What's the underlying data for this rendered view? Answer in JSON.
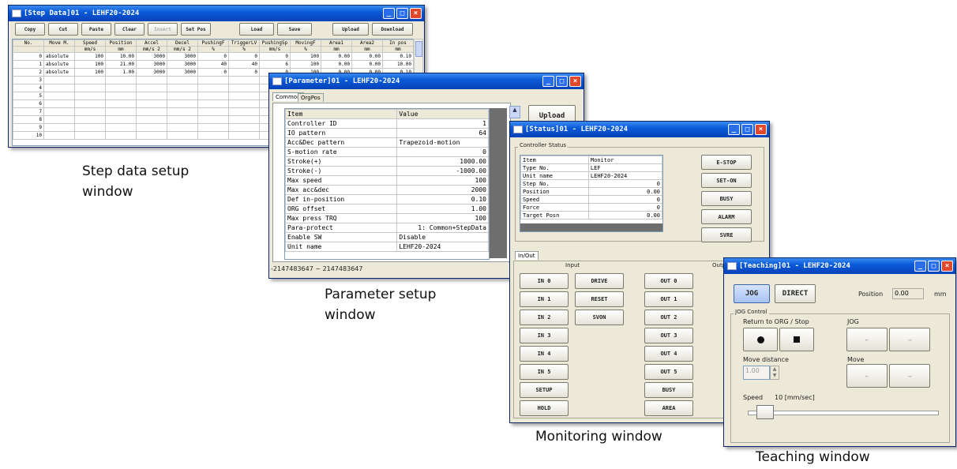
{
  "step_window": {
    "title": "[Step Data]01 - LEHF20-2024",
    "toolbar": [
      "Copy",
      "Cut",
      "Paste",
      "Clear",
      "Insert",
      "Set Pos",
      "Load",
      "Save",
      "Upload",
      "Download"
    ],
    "columns": [
      [
        "No.",
        ""
      ],
      [
        "Move M.",
        ""
      ],
      [
        "Speed",
        "mm/s"
      ],
      [
        "Position",
        "mm"
      ],
      [
        "Accel",
        "mm/s 2"
      ],
      [
        "Decel",
        "mm/s 2"
      ],
      [
        "PushingF",
        "%"
      ],
      [
        "TriggerLV",
        "%"
      ],
      [
        "PushingSp",
        "mm/s"
      ],
      [
        "MovingF",
        "%"
      ],
      [
        "Area1",
        "mm"
      ],
      [
        "Area2",
        "mm"
      ],
      [
        "In pos",
        "mm"
      ]
    ],
    "rows": [
      [
        "0",
        "absolute",
        "100",
        "10.00",
        "3000",
        "3000",
        "0",
        "0",
        "0",
        "100",
        "0.00",
        "0.00",
        "0.10"
      ],
      [
        "1",
        "absolute",
        "100",
        "21.00",
        "3000",
        "3000",
        "40",
        "40",
        "6",
        "100",
        "0.00",
        "0.00",
        "10.00"
      ],
      [
        "2",
        "absolute",
        "100",
        "1.00",
        "3000",
        "3000",
        "0",
        "0",
        "0",
        "100",
        "0.00",
        "0.00",
        "0.10"
      ],
      [
        "3",
        "",
        "",
        "",
        "",
        "",
        "",
        "",
        "",
        "",
        "",
        "",
        ""
      ],
      [
        "4",
        "",
        "",
        "",
        "",
        "",
        "",
        "",
        "",
        "",
        "",
        "",
        ""
      ],
      [
        "5",
        "",
        "",
        "",
        "",
        "",
        "",
        "",
        "",
        "",
        "",
        "",
        ""
      ],
      [
        "6",
        "",
        "",
        "",
        "",
        "",
        "",
        "",
        "",
        "",
        "",
        "",
        ""
      ],
      [
        "7",
        "",
        "",
        "",
        "",
        "",
        "",
        "",
        "",
        "",
        "",
        "",
        ""
      ],
      [
        "8",
        "",
        "",
        "",
        "",
        "",
        "",
        "",
        "",
        "",
        "",
        "",
        ""
      ],
      [
        "9",
        "",
        "",
        "",
        "",
        "",
        "",
        "",
        "",
        "",
        "",
        "",
        ""
      ],
      [
        "10",
        "",
        "",
        "",
        "",
        "",
        "",
        "",
        "",
        "",
        "",
        "",
        ""
      ]
    ],
    "caption_line1": "Step data setup",
    "caption_line2": "window"
  },
  "param_window": {
    "title": "[Parameter]01 - LEHF20-2024",
    "tabs": [
      "Common",
      "OrgPos"
    ],
    "header": [
      "Item",
      "Value"
    ],
    "rows": [
      [
        "Controller ID",
        "1"
      ],
      [
        "IO pattern",
        "64"
      ],
      [
        "Acc&Dec pattern",
        "Trapezoid-motion"
      ],
      [
        "S-motion rate",
        "0"
      ],
      [
        "Stroke(+)",
        "1000.00"
      ],
      [
        "Stroke(-)",
        "-1000.00"
      ],
      [
        "Max speed",
        "100"
      ],
      [
        "Max acc&dec",
        "2000"
      ],
      [
        "Def in-position",
        "0.10"
      ],
      [
        "ORG offset",
        "1.00"
      ],
      [
        "Max press TRQ",
        "100"
      ],
      [
        "Para-protect",
        "1: Common+StepData"
      ],
      [
        "Enable SW",
        "Disable"
      ],
      [
        "Unit name",
        "LEHF20-2024"
      ]
    ],
    "upload_label": "Upload",
    "range_text": "-2147483647 ~ 2147483647",
    "caption_line1": "Parameter setup",
    "caption_line2": "window"
  },
  "status_window": {
    "title": "[Status]01 - LEHF20-2024",
    "group_label": "Controller Status",
    "header": [
      "Item",
      "Monitor"
    ],
    "rows": [
      [
        "Type No.",
        "LEF"
      ],
      [
        "Unit name",
        "LEHF20-2024"
      ],
      [
        "Step No.",
        "0"
      ],
      [
        "Position",
        "0.00"
      ],
      [
        "Speed",
        "0"
      ],
      [
        "Force",
        "0"
      ],
      [
        "Target Posn",
        "0.00"
      ]
    ],
    "side_buttons": [
      "E-STOP",
      "SET-ON",
      "BUSY",
      "ALARM",
      "SVRE"
    ],
    "io_tab": "In/Out",
    "input_label": "Input",
    "output_label": "Output",
    "inputs_col1": [
      "IN 0",
      "IN 1",
      "IN 2",
      "IN 3",
      "IN 4",
      "IN 5",
      "SETUP",
      "HOLD"
    ],
    "inputs_col2": [
      "DRIVE",
      "RESET",
      "SVON"
    ],
    "outputs_col1": [
      "OUT 0",
      "OUT 1",
      "OUT 2",
      "OUT 3",
      "OUT 4",
      "OUT 5",
      "BUSY",
      "AREA"
    ],
    "caption": "Monitoring window"
  },
  "teaching_window": {
    "title": "[Teaching]01 - LEHF20-2024",
    "mode_tabs": [
      "JOG",
      "DIRECT"
    ],
    "position_label": "Position",
    "position_value": "0.00",
    "position_unit": "mm",
    "group_label": "JOG Control",
    "return_label": "Return to ORG / Stop",
    "jog_label": "JOG",
    "move_distance_label": "Move distance",
    "move_distance_value": "1.00",
    "move_label": "Move",
    "speed_label": "Speed",
    "speed_value": "10 [mm/sec]",
    "speed_fraction": 0.05,
    "caption": "Teaching window"
  }
}
